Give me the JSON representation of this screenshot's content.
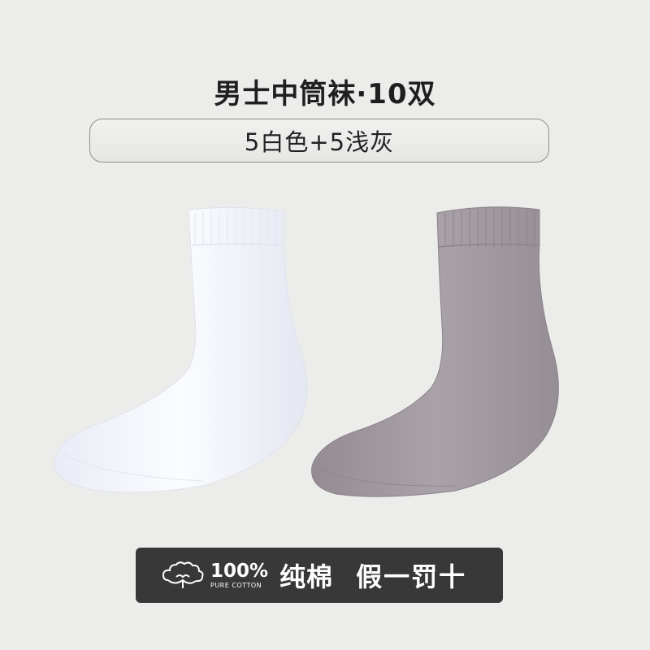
{
  "header": {
    "title": "男士中筒袜·10双",
    "subtitle": "5白色+5浅灰"
  },
  "product": {
    "socks": [
      {
        "color_name": "白色",
        "color": "#f4f5fb"
      },
      {
        "color_name": "浅灰",
        "color": "#a49ca3"
      }
    ]
  },
  "badge": {
    "icon": "cotton-icon",
    "percent": "100%",
    "pure_cotton": "PURE COTTON",
    "material": "纯棉",
    "guarantee": "假一罚十",
    "background": "#383838"
  }
}
